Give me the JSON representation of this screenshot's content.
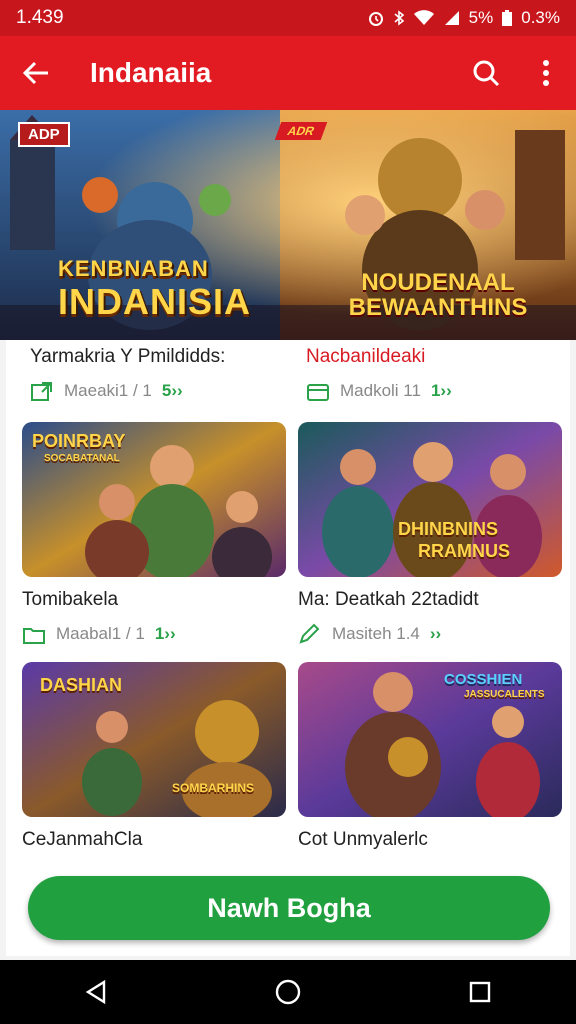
{
  "status_bar": {
    "time": "1.439",
    "battery_pct": "5%",
    "signal_text": "0.3%"
  },
  "app_bar": {
    "title": "Indanaiia"
  },
  "banner": {
    "logo_text": "ADP",
    "flag_text": "ADR",
    "left_title_line1": "KENBNABAN",
    "left_title_line2": "INDANISIA",
    "right_title_line1": "NOUDENAAL",
    "right_title_line2": "BEWAANTHINS"
  },
  "cards": [
    {
      "name": "Yarmakria Y Pmildidds:",
      "meta": "Maeaki1 / 1",
      "chev": "5››",
      "icon": "share-icon",
      "thumb_text": "",
      "name_color": "#222222"
    },
    {
      "name": "Nacbanildeaki",
      "meta": "Madkoli 11",
      "chev": "1››",
      "icon": "wallet-icon",
      "thumb_text": "",
      "name_color": "#d81b22"
    },
    {
      "name": "Tomibakela",
      "meta": "Maabal1 / 1",
      "chev": "1››",
      "icon": "folder-icon",
      "thumb_text": "POINRBAY",
      "thumb_sub": "SOCABATANAL"
    },
    {
      "name": "Ma: Deatkah 22tadidt",
      "meta": "Masiteh 1.4",
      "chev": "››",
      "icon": "pencil-icon",
      "thumb_text": "DHINBNINS",
      "thumb_sub": "RRAMNUS"
    },
    {
      "name": "CeJanmahCla",
      "meta": "",
      "chev": "",
      "icon": "",
      "thumb_text": "DASHIAN",
      "thumb_sub": "SOMBARHINS"
    },
    {
      "name": "Cot Unmyalerlc",
      "meta": "",
      "chev": "",
      "icon": "",
      "thumb_text": "COSSHIEN",
      "thumb_sub": "JASSUCALENTS"
    }
  ],
  "cta": {
    "label": "Nawh Bogha"
  },
  "colors": {
    "primary": "#e21b23",
    "status": "#c8161d",
    "accent_green": "#21a03f"
  }
}
